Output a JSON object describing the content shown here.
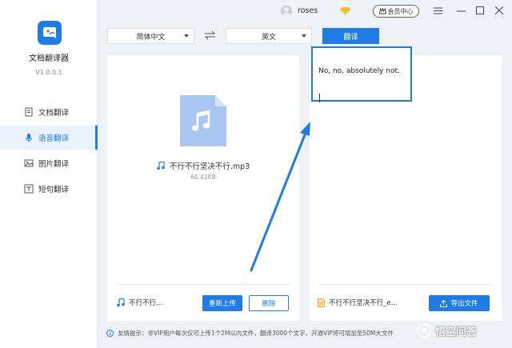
{
  "app": {
    "name": "文档翻译器",
    "version": "V1.0.0.1"
  },
  "sidebar": {
    "items": [
      {
        "label": "文档翻译",
        "icon": "document-icon",
        "active": false
      },
      {
        "label": "语音翻译",
        "icon": "microphone-icon",
        "active": true
      },
      {
        "label": "图片翻译",
        "icon": "image-icon",
        "active": false
      },
      {
        "label": "短句翻译",
        "icon": "text-icon",
        "active": false
      }
    ]
  },
  "titlebar": {
    "username": "roses",
    "member_label": "会员中心",
    "icons": [
      "user-avatar",
      "vip-diamond-icon",
      "menu-icon",
      "minimize-icon",
      "maximize-icon",
      "close-icon"
    ]
  },
  "toolbar": {
    "source_language": "简体中文",
    "target_language": "英文",
    "translate_label": "翻译"
  },
  "left_panel": {
    "file_name": "不行不行坚决不行.mp3",
    "file_size": "60.42KB",
    "footer_file": "不行不行...",
    "reupload_label": "重新上传",
    "delete_label": "删除"
  },
  "right_panel": {
    "result_text": "No, no, absolutely not.",
    "footer_file": "不行不行坚决不行_e...",
    "export_label": "导出文件"
  },
  "footer": {
    "tip": "友情提示：非VIP用户每次仅可上传1个2M以内文件，翻译3000个文字，开通VIP将可增加至50M大文件"
  },
  "watermark": {
    "text": "悟空问答"
  },
  "colors": {
    "accent": "#1f7be6",
    "background": "#eef1f6",
    "sidebar_active_bg": "#eaf2fd"
  }
}
